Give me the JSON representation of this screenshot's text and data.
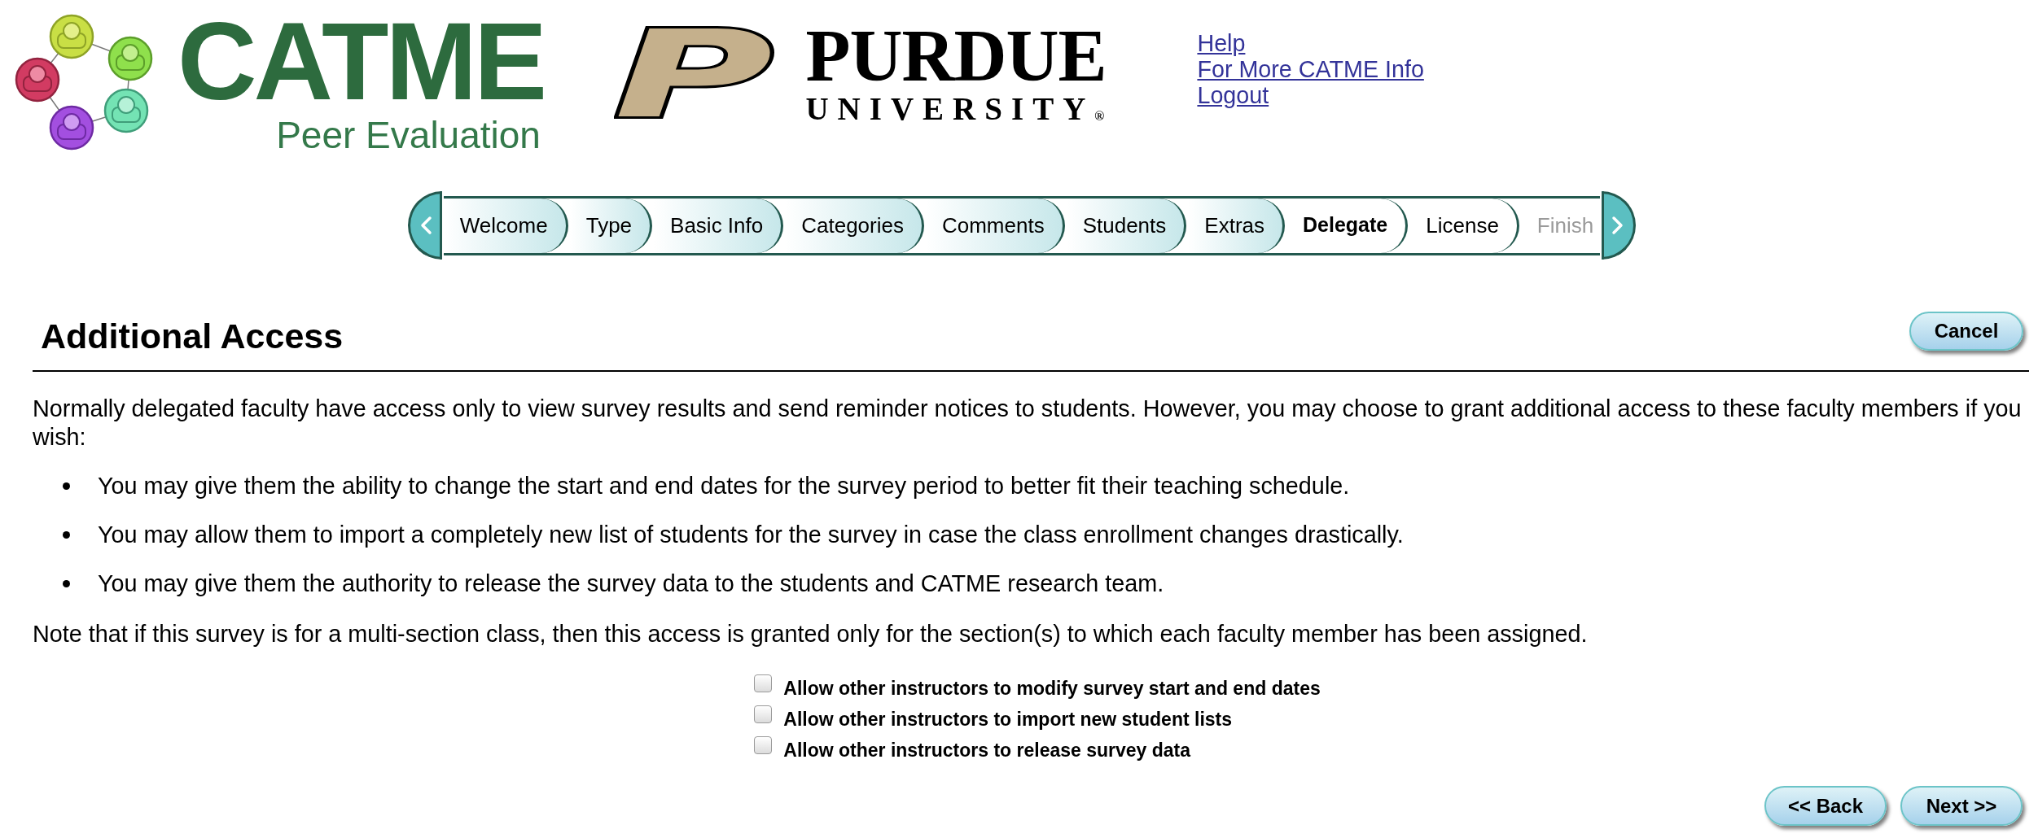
{
  "header": {
    "logo": {
      "title": "CATME",
      "subtitle": "Peer Evaluation"
    },
    "university": {
      "letter": "P",
      "name": "PURDUE",
      "subname": "UNIVERSITY",
      "mark": "®"
    },
    "links": [
      "Help",
      "For More CATME Info",
      "Logout"
    ]
  },
  "steps": {
    "tabs": [
      {
        "label": "Welcome",
        "selected": false,
        "visited": true,
        "disabled": false
      },
      {
        "label": "Type",
        "selected": false,
        "visited": true,
        "disabled": false
      },
      {
        "label": "Basic Info",
        "selected": false,
        "visited": true,
        "disabled": false
      },
      {
        "label": "Categories",
        "selected": false,
        "visited": true,
        "disabled": false
      },
      {
        "label": "Comments",
        "selected": false,
        "visited": true,
        "disabled": false
      },
      {
        "label": "Students",
        "selected": false,
        "visited": true,
        "disabled": false
      },
      {
        "label": "Extras",
        "selected": false,
        "visited": true,
        "disabled": false
      },
      {
        "label": "Delegate",
        "selected": true,
        "visited": false,
        "disabled": false
      },
      {
        "label": "License",
        "selected": false,
        "visited": false,
        "disabled": false
      },
      {
        "label": "Finish",
        "selected": false,
        "visited": false,
        "disabled": true
      }
    ]
  },
  "page": {
    "title": "Additional Access",
    "cancel": "Cancel",
    "intro": "Normally delegated faculty have access only to view survey results and send reminder notices to students. However, you may choose to grant additional access to these faculty members if you wish:",
    "bullets": [
      "You may give them the ability to change the start and end dates for the survey period to better fit their teaching schedule.",
      "You may allow them to import a completely new list of students for the survey in case the class enrollment changes drastically.",
      "You may give them the authority to release the survey data to the students and CATME research team."
    ],
    "note": "Note that if this survey is for a multi-section class, then this access is granted only for the section(s) to which each faculty member has been assigned.",
    "options": [
      {
        "label": "Allow other instructors to modify survey start and end dates",
        "checked": false
      },
      {
        "label": "Allow other instructors to import new student lists",
        "checked": false
      },
      {
        "label": "Allow other instructors to release survey data",
        "checked": false
      }
    ],
    "buttons": [
      "<< Back",
      "Next >>"
    ]
  }
}
